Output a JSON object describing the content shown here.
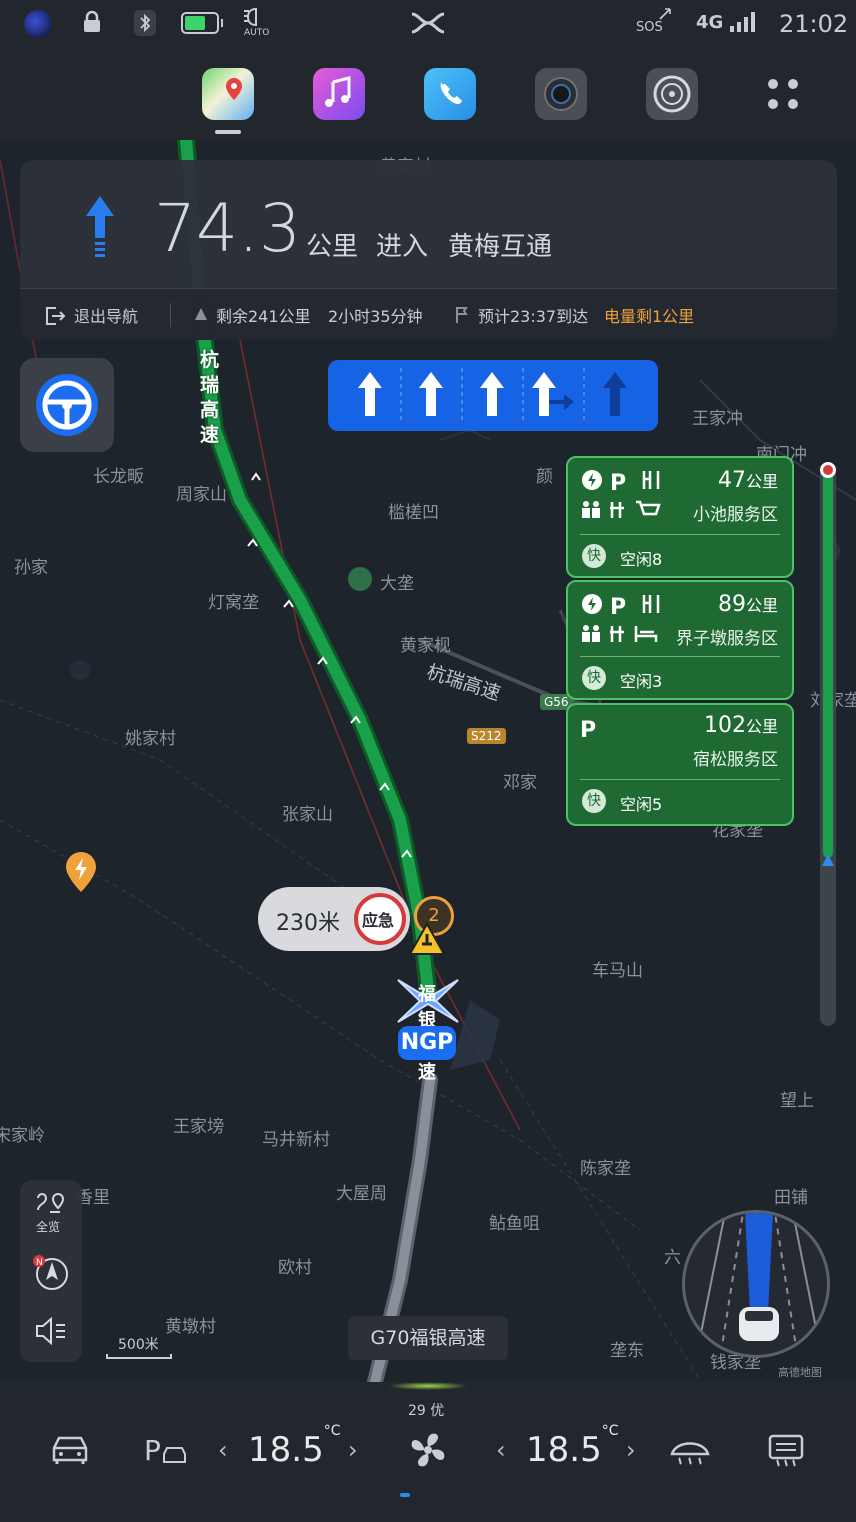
{
  "status_bar": {
    "sos": "SOS",
    "network": "4G",
    "time": "21:02",
    "headlight_mode": "AUTO"
  },
  "dock": {
    "apps": [
      {
        "name": "maps",
        "active": true
      },
      {
        "name": "music",
        "active": false
      },
      {
        "name": "phone",
        "active": false
      },
      {
        "name": "camera",
        "active": false
      },
      {
        "name": "settings",
        "active": false
      },
      {
        "name": "app-grid",
        "active": false
      }
    ]
  },
  "guidance": {
    "distance": "74.3",
    "unit": "公里",
    "action": "进入",
    "target": "黄梅互通",
    "exit_nav": "退出导航",
    "remaining": "剩余241公里",
    "duration": "2小时35分钟",
    "eta": "预计23:37到达",
    "battery_warning": "电量剩1公里"
  },
  "lanes": [
    "straight",
    "straight",
    "straight",
    "straight-right",
    "straight"
  ],
  "service_areas": [
    {
      "km": "47",
      "unit": "公里",
      "name": "小池服务区",
      "fast": "快",
      "idle": "空闲8"
    },
    {
      "km": "89",
      "unit": "公里",
      "name": "界子墩服务区",
      "fast": "快",
      "idle": "空闲3"
    },
    {
      "km": "102",
      "unit": "公里",
      "name": "宿松服务区",
      "fast": "快",
      "idle": "空闲5"
    }
  ],
  "map": {
    "road_vertical": "杭瑞高速",
    "road_diagonal": "杭瑞高速",
    "road_fuyin_chars": [
      "福",
      "银",
      "速"
    ],
    "ngp": "NGP",
    "hazard_distance": "230米",
    "hazard_label": "应急",
    "hazard_count": "2",
    "current_road": "G70福银高速",
    "scale": "500米",
    "attribution": "高德地图",
    "badge_s212": "S212",
    "badge_g56": "G56",
    "places": [
      {
        "name": "黄家村"
      },
      {
        "name": "王家冲"
      },
      {
        "name": "南门冲"
      },
      {
        "name": "长龙畈"
      },
      {
        "name": "颜"
      },
      {
        "name": "周家山"
      },
      {
        "name": "槛槎凹"
      },
      {
        "name": "孙家"
      },
      {
        "name": "大垄"
      },
      {
        "name": "灯窝垄"
      },
      {
        "name": "黄家枧"
      },
      {
        "name": "姚家村"
      },
      {
        "name": "邓家"
      },
      {
        "name": "张家山"
      },
      {
        "name": "刘家垄"
      },
      {
        "name": "花家垄"
      },
      {
        "name": "车马山"
      },
      {
        "name": "望上"
      },
      {
        "name": "宋家岭"
      },
      {
        "name": "王家塝"
      },
      {
        "name": "马井新村"
      },
      {
        "name": "陈家垄"
      },
      {
        "name": "大屋周"
      },
      {
        "name": "田铺"
      },
      {
        "name": "香里"
      },
      {
        "name": "鲇鱼咀"
      },
      {
        "name": "六"
      },
      {
        "name": "欧村"
      },
      {
        "name": "黄墩村"
      },
      {
        "name": "垄东"
      },
      {
        "name": "钱家垄"
      }
    ]
  },
  "left_controls": {
    "overview": "全览"
  },
  "climate": {
    "aqi": "29 优",
    "left_temp": "18.5",
    "right_temp": "18.5",
    "unit": "°C"
  }
}
